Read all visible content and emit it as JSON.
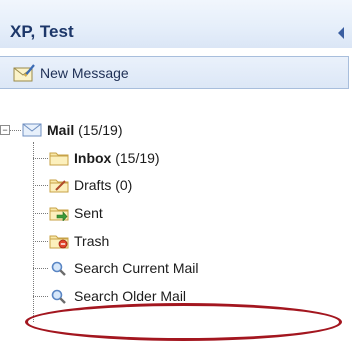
{
  "header": {
    "title": "XP, Test",
    "collapse_icon": "chevron-left-icon"
  },
  "toolbar": {
    "new_message_label": "New Message",
    "new_message_icon": "compose-mail-icon"
  },
  "tree": {
    "root": {
      "name": "Mail",
      "count": "(15/19)",
      "icon": "mail-envelope-icon",
      "expanded": true
    },
    "items": [
      {
        "name": "Inbox",
        "count": "(15/19)",
        "bold": true,
        "icon": "inbox-folder-icon"
      },
      {
        "name": "Drafts",
        "count": "(0)",
        "bold": false,
        "icon": "drafts-folder-icon"
      },
      {
        "name": "Sent",
        "count": "",
        "bold": false,
        "icon": "sent-folder-icon"
      },
      {
        "name": "Trash",
        "count": "",
        "bold": false,
        "icon": "trash-folder-icon"
      },
      {
        "name": "Search Current Mail",
        "count": "",
        "bold": false,
        "icon": "search-icon"
      },
      {
        "name": "Search Older Mail",
        "count": "",
        "bold": false,
        "icon": "search-icon",
        "highlighted": true
      }
    ]
  },
  "colors": {
    "header_text": "#1d3769",
    "highlight": "#a3161f"
  }
}
